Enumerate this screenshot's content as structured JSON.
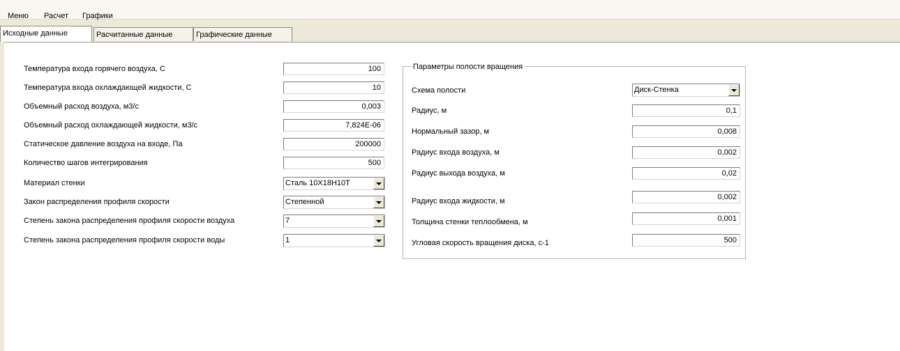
{
  "menu": {
    "items": [
      {
        "label": "Меню"
      },
      {
        "label": "Расчет"
      },
      {
        "label": "Графики"
      }
    ]
  },
  "tabs": [
    {
      "label": "Исходные данные",
      "active": true
    },
    {
      "label": "Расчитанные данные",
      "active": false
    },
    {
      "label": "Графические данные",
      "active": false
    }
  ],
  "left_form": {
    "rows": [
      {
        "label": "Температура входа горячего воздуха, С",
        "value": "100"
      },
      {
        "label": "Температура входа охлаждающей жидкости, С",
        "value": "10"
      },
      {
        "label": "Объемный расход воздуха, м3/с",
        "value": "0,003"
      },
      {
        "label": "Объемный расход охлаждающей жидкости, м3/с",
        "value": "7,824E-06"
      },
      {
        "label": "Статическое давление воздуха на входе, Па",
        "value": "200000"
      },
      {
        "label": "Количество шагов интегрирования",
        "value": "500"
      }
    ],
    "selects": [
      {
        "label": "Материал стенки",
        "value": "Сталь 10Х18Н10Т"
      },
      {
        "label": "Закон распределения профиля скорости",
        "value": "Степенной"
      },
      {
        "label": "Степень закона распределения профиля скорости воздуха",
        "value": "7"
      },
      {
        "label": "Степень закона распределения профиля скорости воды",
        "value": "1"
      }
    ]
  },
  "cavity": {
    "title": "Параметры полости вращения",
    "scheme_label": "Схема полости",
    "scheme_value": "Диск-Стенка",
    "rows": [
      {
        "label": "Радиус, м",
        "value": "0,1"
      },
      {
        "label": "Нормальный зазор, м",
        "value": "0,008"
      },
      {
        "label": "Радиус входа воздуха, м",
        "value": "0,002"
      },
      {
        "label": "Радиус выхода воздуха, м",
        "value": "0,02"
      },
      {
        "label": "Радиус входа жидкости, м",
        "value": "0,002"
      },
      {
        "label": "Толщина стенки теплообмена, м",
        "value": "0,001"
      },
      {
        "label": "Угловая скорость вращения диска, с-1",
        "value": "500"
      }
    ]
  }
}
